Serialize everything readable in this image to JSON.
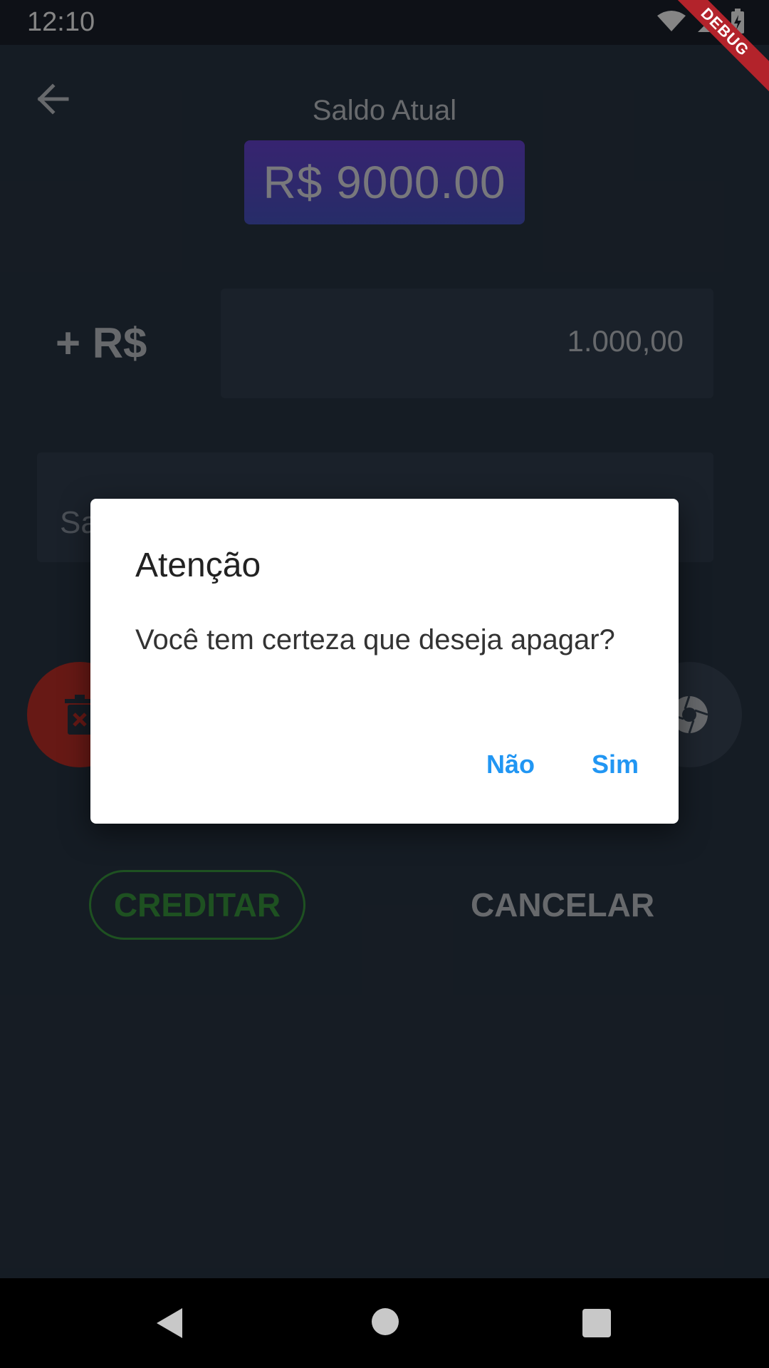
{
  "status_bar": {
    "time": "12:10",
    "icons": [
      "wifi-icon",
      "signal-icon",
      "battery-icon"
    ]
  },
  "debug_banner": "DEBUG",
  "header": {
    "back_icon": "arrow-left-icon",
    "balance_label": "Saldo Atual",
    "balance_value": "R$ 9000.00"
  },
  "form": {
    "currency_prefix": "+ R$",
    "amount_value": "1.000,00",
    "description_placeholder": "Sa"
  },
  "actions": {
    "credit_label": "CREDITAR",
    "cancel_label": "CANCELAR"
  },
  "dialog": {
    "title": "Atenção",
    "message": "Você tem certeza que deseja apagar?",
    "no_label": "Não",
    "yes_label": "Sim"
  },
  "colors": {
    "background": "#2a3645",
    "accent_blue": "#2196f3",
    "credit_green": "#3b9c40",
    "delete_red": "#c6302a",
    "balance_gradient_start": "#6a45d7",
    "balance_gradient_end": "#4a56c8"
  }
}
